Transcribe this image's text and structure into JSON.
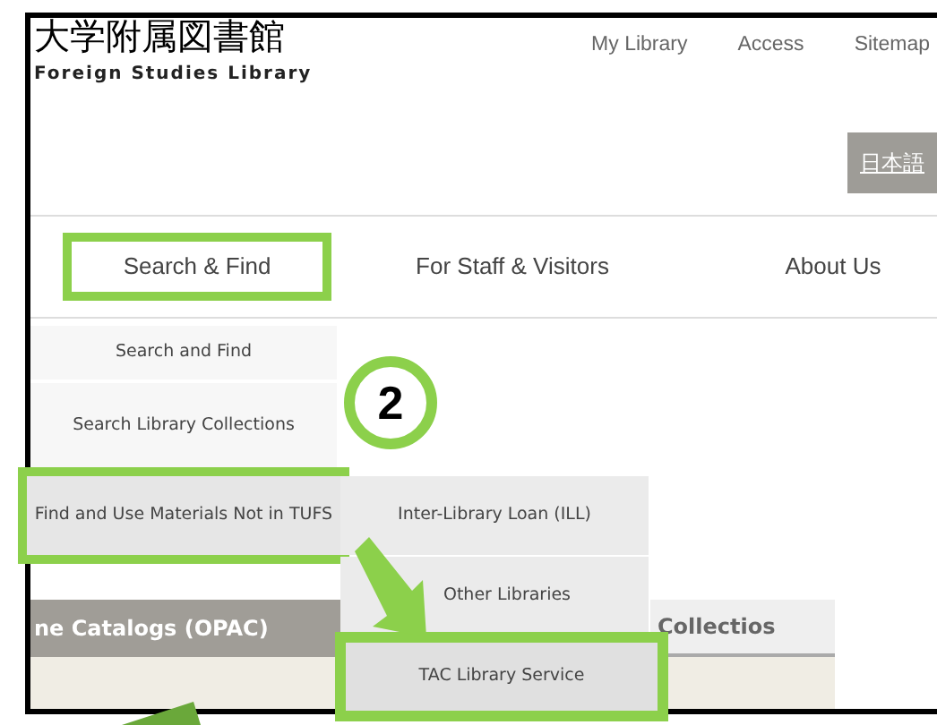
{
  "header": {
    "logo_title": "大学附属図書館",
    "logo_subtitle": "Foreign Studies Library",
    "top_links": [
      "My Library",
      "Access",
      "Sitemap"
    ],
    "language_button": "日本語"
  },
  "nav": [
    {
      "label": "Search & Find",
      "selected": true
    },
    {
      "label": "For Staff & Visitors",
      "selected": false
    },
    {
      "label": "About Us",
      "selected": false
    }
  ],
  "dropdown": [
    {
      "label": "Search and Find",
      "selected": false
    },
    {
      "label": "Search Library Collections",
      "selected": false
    },
    {
      "label": "Find and Use Materials Not in TUFS",
      "selected": true
    }
  ],
  "submenu": [
    {
      "label": "Inter-Library Loan (ILL)",
      "selected": false
    },
    {
      "label": "Other Libraries",
      "selected": false
    },
    {
      "label": "TAC Library Service",
      "selected": true
    }
  ],
  "content_tabs": [
    {
      "label": "ne Catalogs (OPAC)",
      "selected": true
    },
    {
      "label": "Collectios",
      "selected": false
    }
  ],
  "annotation": {
    "step": "2"
  }
}
